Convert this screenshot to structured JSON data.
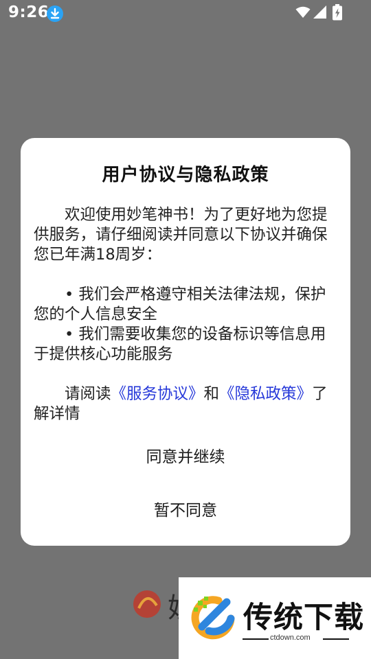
{
  "status_bar": {
    "time": "9:26",
    "icons": [
      "download-notification-icon",
      "wifi-icon",
      "signal-icon",
      "battery-charging-icon"
    ]
  },
  "dialog": {
    "title": "用户协议与隐私政策",
    "intro": "欢迎使用妙笔神书！为了更好地为您提供服务，请仔细阅读并同意以下协议并确保您已年满18周岁：",
    "bullets": [
      "• 我们会严格遵守相关法律法规，保护您的个人信息安全",
      "• 我们需要收集您的设备标识等信息用于提供核心功能服务"
    ],
    "read_prefix": "请阅读",
    "service_agreement_link": "《服务协议》",
    "and_text": "和",
    "privacy_policy_link": "《隐私政策》",
    "read_suffix": "了解详情",
    "agree_button": "同意并继续",
    "decline_button": "暂不同意"
  },
  "background": {
    "app_name_partial": "妙"
  },
  "watermark": {
    "name": "传统下载",
    "url": "ctdown.com"
  },
  "colors": {
    "overlay": "#737373",
    "link": "#2638d9",
    "download_badge": "#2aa3f5"
  }
}
